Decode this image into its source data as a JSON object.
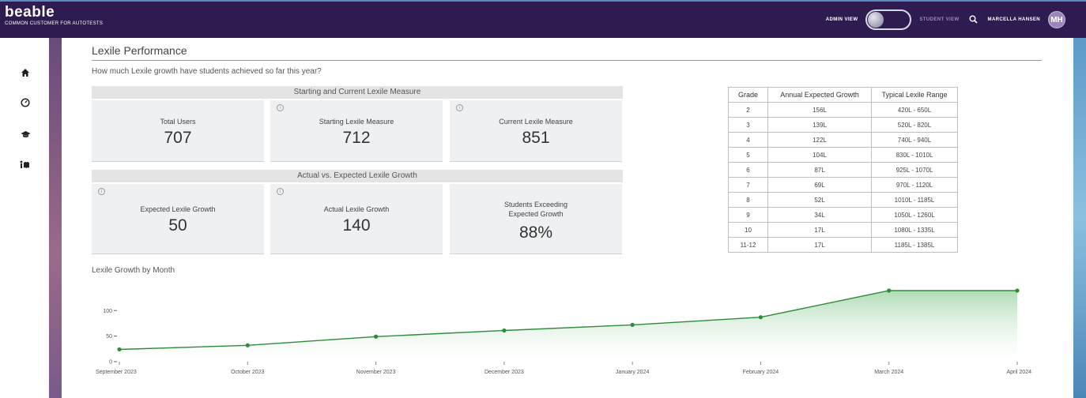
{
  "app": {
    "logo": "beable",
    "subtitle": "COMMON CUSTOMER FOR AUTOTESTS"
  },
  "topbar": {
    "admin_view": "ADMIN VIEW",
    "student_view": "STUDENT VIEW",
    "user_name": "MARCELLA HANSEN",
    "avatar_initials": "MH"
  },
  "sidebar": {
    "icons": [
      "home-icon",
      "gauge-icon",
      "graduation-cap-icon",
      "reading-icon"
    ]
  },
  "page": {
    "title": "Lexile Performance",
    "question": "How much Lexile growth have students achieved so far this year?"
  },
  "section1": {
    "title": "Starting and Current Lexile Measure",
    "cards": [
      {
        "label": "Total Users",
        "value": "707"
      },
      {
        "label": "Starting Lexile Measure",
        "value": "712"
      },
      {
        "label": "Current Lexile Measure",
        "value": "851"
      }
    ]
  },
  "section2": {
    "title": "Actual vs. Expected Lexile Growth",
    "cards": [
      {
        "label": "Expected Lexile Growth",
        "value": "50"
      },
      {
        "label": "Actual Lexile Growth",
        "value": "140"
      },
      {
        "label": "Students Exceeding Expected Growth",
        "value": "88%"
      }
    ]
  },
  "info_glyph": "i",
  "grade_table": {
    "headers": [
      "Grade",
      "Annual Expected Growth",
      "Typical Lexile Range"
    ],
    "rows": [
      [
        "2",
        "156L",
        "420L - 650L"
      ],
      [
        "3",
        "139L",
        "520L - 820L"
      ],
      [
        "4",
        "122L",
        "740L - 940L"
      ],
      [
        "5",
        "104L",
        "830L - 1010L"
      ],
      [
        "6",
        "87L",
        "925L - 1070L"
      ],
      [
        "7",
        "69L",
        "970L - 1120L"
      ],
      [
        "8",
        "52L",
        "1010L - 1185L"
      ],
      [
        "9",
        "34L",
        "1050L - 1260L"
      ],
      [
        "10",
        "17L",
        "1080L - 1335L"
      ],
      [
        "11-12",
        "17L",
        "1185L - 1385L"
      ]
    ]
  },
  "chart_data": {
    "type": "area",
    "title": "Lexile Growth by Month",
    "categories": [
      "September 2023",
      "October 2023",
      "November 2023",
      "December 2023",
      "January 2024",
      "February 2024",
      "March 2024",
      "April 2024"
    ],
    "values": [
      24,
      32,
      49,
      61,
      72,
      87,
      139,
      139
    ],
    "yticks": [
      0,
      50,
      100
    ],
    "ylim": [
      0,
      139
    ],
    "color": "#2e8b3a",
    "grid": false
  },
  "colors": {
    "topbar": "#2e1b4f",
    "line": "#2e8b3a"
  }
}
